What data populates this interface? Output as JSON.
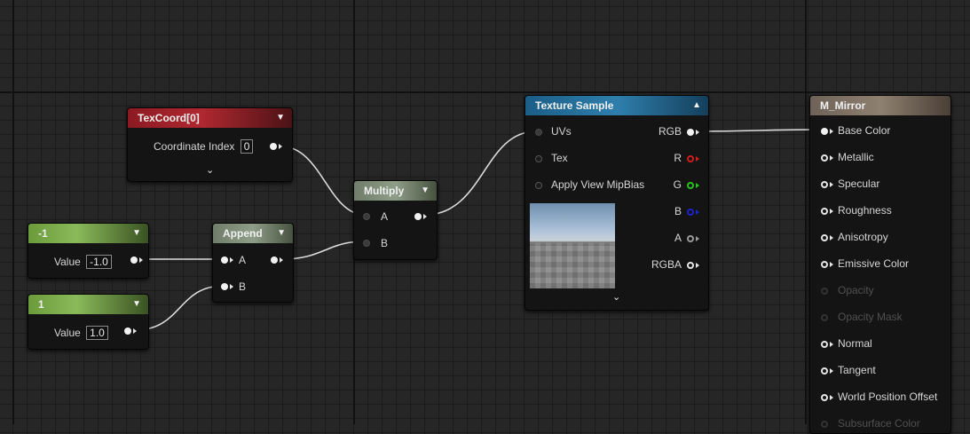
{
  "nodes": {
    "texcoord": {
      "title": "TexCoord[0]",
      "row_label": "Coordinate Index",
      "value": "0"
    },
    "const_neg1": {
      "title": "-1",
      "row_label": "Value",
      "value": "-1.0"
    },
    "const_1": {
      "title": "1",
      "row_label": "Value",
      "value": "1.0"
    },
    "append": {
      "title": "Append",
      "input_a": "A",
      "input_b": "B"
    },
    "multiply": {
      "title": "Multiply",
      "input_a": "A",
      "input_b": "B"
    },
    "texture_sample": {
      "title": "Texture Sample",
      "inputs": [
        "UVs",
        "Tex",
        "Apply View MipBias"
      ],
      "outputs": [
        "RGB",
        "R",
        "G",
        "B",
        "A",
        "RGBA"
      ]
    },
    "material": {
      "title": "M_Mirror",
      "inputs": [
        "Base Color",
        "Metallic",
        "Specular",
        "Roughness",
        "Anisotropy",
        "Emissive Color",
        "Opacity",
        "Opacity Mask",
        "Normal",
        "Tangent",
        "World Position Offset",
        "Subsurface Color"
      ],
      "disabled_inputs": [
        "Opacity",
        "Opacity Mask",
        "Subsurface Color"
      ]
    }
  },
  "colors": {
    "canvas": "#262626",
    "texcoord_header": "#b02830",
    "constant_header": "#8aba5a",
    "math_header": "#8f9e88",
    "texture_header": "#2e7eac",
    "material_header": "#8e8070",
    "pin_r": "#d11c1c",
    "pin_g": "#27c21b",
    "pin_b": "#1e22cc"
  }
}
